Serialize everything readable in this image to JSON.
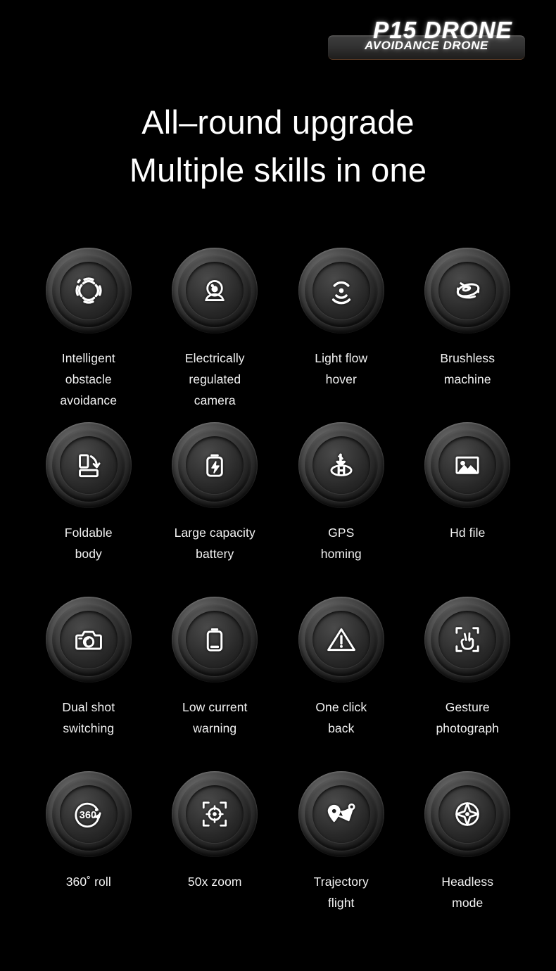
{
  "brand": {
    "title": "P15 DRONE",
    "subtitle": "AVOIDANCE DRONE"
  },
  "headings": {
    "line1": "All–round upgrade",
    "line2": "Multiple skills in one"
  },
  "colors": {
    "background": "#000000",
    "text": "#ffffff",
    "knob_highlight": "#6a6a6a",
    "knob_shadow": "#121212",
    "pill_accent": "#5a3a24"
  },
  "features": [
    {
      "icon": "obstacle-avoidance-icon",
      "label": "Intelligent\nobstacle\navoidance"
    },
    {
      "icon": "gimbal-camera-icon",
      "label": "Electrically\nregulated\ncamera"
    },
    {
      "icon": "optical-flow-icon",
      "label": "Light flow\nhover"
    },
    {
      "icon": "brushless-motor-icon",
      "label": "Brushless\nmachine"
    },
    {
      "icon": "foldable-body-icon",
      "label": "Foldable\nbody"
    },
    {
      "icon": "battery-charge-icon",
      "label": "Large capacity\nbattery"
    },
    {
      "icon": "gps-homing-icon",
      "label": "GPS\nhoming"
    },
    {
      "icon": "hd-image-icon",
      "label": "Hd file"
    },
    {
      "icon": "camera-icon",
      "label": "Dual shot\nswitching"
    },
    {
      "icon": "low-battery-icon",
      "label": "Low current\nwarning"
    },
    {
      "icon": "warning-triangle-icon",
      "label": "One click\nback"
    },
    {
      "icon": "gesture-hand-icon",
      "label": "Gesture\nphotograph"
    },
    {
      "icon": "360-roll-icon",
      "label": "360˚ roll"
    },
    {
      "icon": "zoom-target-icon",
      "label": "50x zoom"
    },
    {
      "icon": "trajectory-route-icon",
      "label": "Trajectory\nflight"
    },
    {
      "icon": "headless-compass-icon",
      "label": "Headless\nmode"
    }
  ]
}
